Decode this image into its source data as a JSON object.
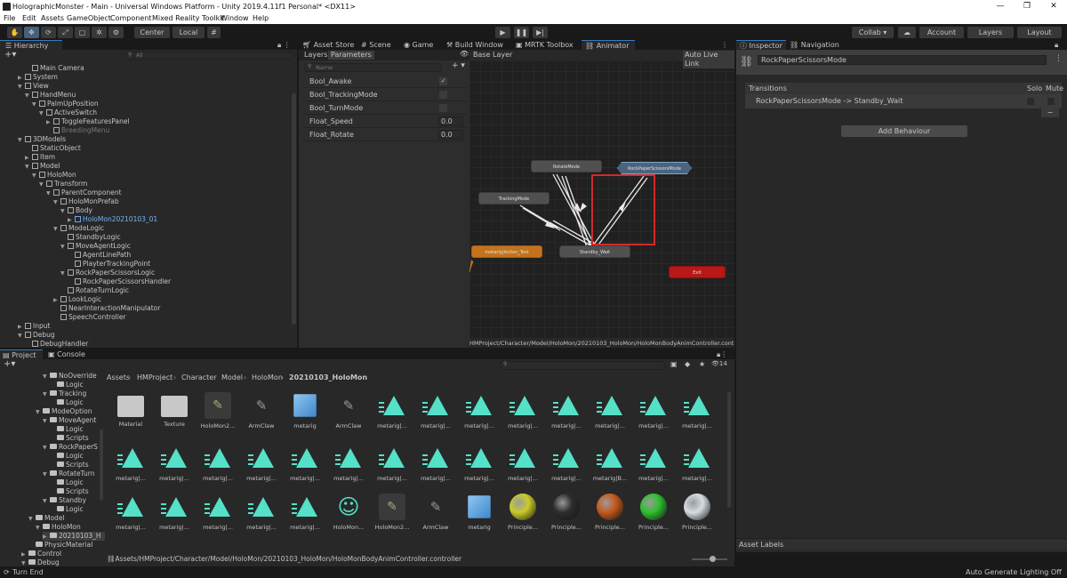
{
  "window": {
    "title": "HolographicMonster - Main - Universal Windows Platform - Unity 2019.4.11f1 Personal* <DX11>",
    "controls": [
      "—",
      "❐",
      "✕"
    ]
  },
  "menu": [
    "File",
    "Edit",
    "Assets",
    "GameObject",
    "Component",
    "Mixed Reality Toolkit",
    "Window",
    "Help"
  ],
  "toolbar": {
    "pivot_label": "Center",
    "space_label": "Local",
    "collab_label": "Collab ▾",
    "account_label": "Account",
    "layers_label": "Layers",
    "layout_label": "Layout"
  },
  "hierarchy": {
    "tab_label": "Hierarchy",
    "search_placeholder": "All",
    "rows": [
      {
        "label": "Main Camera",
        "depth": 3,
        "arrow": "",
        "icon": "cube"
      },
      {
        "label": "System",
        "depth": 2,
        "arrow": "▶",
        "icon": "cube"
      },
      {
        "label": "View",
        "depth": 2,
        "arrow": "▼",
        "icon": "cube"
      },
      {
        "label": "HandMenu",
        "depth": 3,
        "arrow": "▼",
        "icon": "cube"
      },
      {
        "label": "PalmUpPosition",
        "depth": 4,
        "arrow": "▼",
        "icon": "cube"
      },
      {
        "label": "ActiveSwitch",
        "depth": 5,
        "arrow": "▼",
        "icon": "cube"
      },
      {
        "label": "ToggleFeaturesPanel",
        "depth": 6,
        "arrow": "▶",
        "icon": "cube"
      },
      {
        "label": "BreedingMenu",
        "depth": 6,
        "arrow": "",
        "icon": "cube",
        "dim": true
      },
      {
        "label": "3DModels",
        "depth": 2,
        "arrow": "▼",
        "icon": "cube"
      },
      {
        "label": "StaticObject",
        "depth": 3,
        "arrow": "",
        "icon": "cube"
      },
      {
        "label": "Item",
        "depth": 3,
        "arrow": "▶",
        "icon": "cube"
      },
      {
        "label": "Model",
        "depth": 3,
        "arrow": "▼",
        "icon": "cube"
      },
      {
        "label": "HoloMon",
        "depth": 4,
        "arrow": "▼",
        "icon": "cube"
      },
      {
        "label": "Transform",
        "depth": 5,
        "arrow": "▼",
        "icon": "cube"
      },
      {
        "label": "ParentComponent",
        "depth": 6,
        "arrow": "▼",
        "icon": "cube"
      },
      {
        "label": "HoloMonPrefab",
        "depth": 7,
        "arrow": "▼",
        "icon": "cube"
      },
      {
        "label": "Body",
        "depth": 8,
        "arrow": "▼",
        "icon": "cube"
      },
      {
        "label": "HoloMon20210103_01",
        "depth": 9,
        "arrow": "▶",
        "icon": "blue"
      },
      {
        "label": "ModeLogic",
        "depth": 7,
        "arrow": "▼",
        "icon": "cube"
      },
      {
        "label": "StandbyLogic",
        "depth": 8,
        "arrow": "",
        "icon": "cube"
      },
      {
        "label": "MoveAgentLogic",
        "depth": 8,
        "arrow": "▼",
        "icon": "cube"
      },
      {
        "label": "AgentLinePath",
        "depth": 9,
        "arrow": "",
        "icon": "cube"
      },
      {
        "label": "PlayterTrackingPoint",
        "depth": 9,
        "arrow": "",
        "icon": "cube"
      },
      {
        "label": "RockPaperScissorsLogic",
        "depth": 8,
        "arrow": "▼",
        "icon": "cube"
      },
      {
        "label": "RockPaperScissorsHandler",
        "depth": 9,
        "arrow": "",
        "icon": "cube"
      },
      {
        "label": "RotateTurnLogic",
        "depth": 8,
        "arrow": "",
        "icon": "cube"
      },
      {
        "label": "LookLogic",
        "depth": 7,
        "arrow": "▶",
        "icon": "cube"
      },
      {
        "label": "NearInteractionManipulator",
        "depth": 7,
        "arrow": "",
        "icon": "cube"
      },
      {
        "label": "SpeechController",
        "depth": 7,
        "arrow": "",
        "icon": "cube"
      },
      {
        "label": "Input",
        "depth": 2,
        "arrow": "▶",
        "icon": "cube"
      },
      {
        "label": "Debug",
        "depth": 2,
        "arrow": "▼",
        "icon": "cube"
      },
      {
        "label": "DebugHandler",
        "depth": 3,
        "arrow": "",
        "icon": "cube"
      }
    ]
  },
  "center_tabs": [
    "Asset Store",
    "Scene",
    "Game",
    "Build Window",
    "MRTK Toolbox",
    "Animator"
  ],
  "animator": {
    "layers_tab": "Layers",
    "parameters_tab": "Parameters",
    "search_placeholder": "Name",
    "add_button": "+ ▾",
    "layer_name": "Base Layer",
    "auto_live_link": "Auto Live Link",
    "parameters": [
      {
        "name": "Bool_Awake",
        "type": "bool",
        "value": "✓"
      },
      {
        "name": "Bool_TrackingMode",
        "type": "bool",
        "value": ""
      },
      {
        "name": "Bool_TurnMode",
        "type": "bool",
        "value": ""
      },
      {
        "name": "Float_Speed",
        "type": "float",
        "value": "0.0"
      },
      {
        "name": "Float_Rotate",
        "type": "float",
        "value": "0.0"
      }
    ],
    "states": {
      "rotate": "RotateMode",
      "rps": "RockPaperScissorsMode",
      "tracking": "TrackingMode",
      "standby": "Standby_Wait",
      "action": "metarig|Action_Test",
      "exit": "Exit"
    },
    "path": "HMProject/Character/Model/HoloMon/20210103_HoloMon/HoloMonBodyAnimController.controller"
  },
  "inspector": {
    "tab_label": "Inspector",
    "nav_label": "Navigation",
    "object_name": "RockPaperScissorsMode",
    "transitions_header": "Transitions",
    "solo_label": "Solo",
    "mute_label": "Mute",
    "transition_item": "RockPaperScissorsMode -> Standby_Wait",
    "minus_label": "−",
    "add_behaviour": "Add Behaviour",
    "asset_labels": "Asset Labels"
  },
  "project": {
    "tab_label": "Project",
    "console_label": "Console",
    "hidden_count": "14",
    "breadcrumb": [
      "Assets",
      "HMProject",
      "Character",
      "Model",
      "HoloMon",
      "20210103_HoloMon"
    ],
    "tree": [
      {
        "label": "NoOverride",
        "depth": 1,
        "arrow": "▼"
      },
      {
        "label": "Logic",
        "depth": 2,
        "arrow": ""
      },
      {
        "label": "Tracking",
        "depth": 1,
        "arrow": "▼"
      },
      {
        "label": "Logic",
        "depth": 2,
        "arrow": ""
      },
      {
        "label": "ModeOption",
        "depth": 0,
        "arrow": "▼"
      },
      {
        "label": "MoveAgent",
        "depth": 1,
        "arrow": "▼"
      },
      {
        "label": "Logic",
        "depth": 2,
        "arrow": ""
      },
      {
        "label": "Scripts",
        "depth": 2,
        "arrow": ""
      },
      {
        "label": "RockPaperS",
        "depth": 1,
        "arrow": "▼"
      },
      {
        "label": "Logic",
        "depth": 2,
        "arrow": ""
      },
      {
        "label": "Scripts",
        "depth": 2,
        "arrow": ""
      },
      {
        "label": "RotateTurn",
        "depth": 1,
        "arrow": "▼"
      },
      {
        "label": "Logic",
        "depth": 2,
        "arrow": ""
      },
      {
        "label": "Scripts",
        "depth": 2,
        "arrow": ""
      },
      {
        "label": "Standby",
        "depth": 1,
        "arrow": "▼"
      },
      {
        "label": "Logic",
        "depth": 2,
        "arrow": ""
      },
      {
        "label": "Model",
        "depth": -1,
        "arrow": "▼"
      },
      {
        "label": "HoloMon",
        "depth": 0,
        "arrow": "▼"
      },
      {
        "label": "20210103_H",
        "depth": 1,
        "arrow": "▶",
        "selected": true
      },
      {
        "label": "PhysicMaterial",
        "depth": -1,
        "arrow": ""
      },
      {
        "label": "Control",
        "depth": -2,
        "arrow": "▶"
      },
      {
        "label": "Debug",
        "depth": -2,
        "arrow": "▼"
      }
    ],
    "row1": [
      {
        "label": "Material",
        "kind": "folder"
      },
      {
        "label": "Texture",
        "kind": "folder"
      },
      {
        "label": "HoloMon2...",
        "kind": "fbx"
      },
      {
        "label": "ArmClaw",
        "kind": "mesh"
      },
      {
        "label": "metarig",
        "kind": "box"
      },
      {
        "label": "ArmClaw",
        "kind": "mesh2"
      },
      {
        "label": "metarig|...",
        "kind": "anim"
      },
      {
        "label": "metarig|...",
        "kind": "anim"
      },
      {
        "label": "metarig|...",
        "kind": "anim"
      },
      {
        "label": "metarig|...",
        "kind": "anim"
      },
      {
        "label": "metarig|...",
        "kind": "anim"
      },
      {
        "label": "metarig|...",
        "kind": "anim"
      },
      {
        "label": "metarig|...",
        "kind": "anim"
      },
      {
        "label": "metarig|...",
        "kind": "anim"
      }
    ],
    "row2": [
      {
        "label": "metarig|...",
        "kind": "anim"
      },
      {
        "label": "metarig|...",
        "kind": "anim"
      },
      {
        "label": "metarig|...",
        "kind": "anim"
      },
      {
        "label": "metarig|...",
        "kind": "anim"
      },
      {
        "label": "metarig|...",
        "kind": "anim"
      },
      {
        "label": "metarig|...",
        "kind": "anim"
      },
      {
        "label": "metarig|...",
        "kind": "anim"
      },
      {
        "label": "metarig|...",
        "kind": "anim"
      },
      {
        "label": "metarig|...",
        "kind": "anim"
      },
      {
        "label": "metarig|...",
        "kind": "anim"
      },
      {
        "label": "metarig|...",
        "kind": "anim"
      },
      {
        "label": "metarig|B...",
        "kind": "anim"
      },
      {
        "label": "metarig|...",
        "kind": "anim"
      },
      {
        "label": "metarig|...",
        "kind": "anim"
      }
    ],
    "row3": [
      {
        "label": "metarig|...",
        "kind": "anim"
      },
      {
        "label": "metarig|...",
        "kind": "anim"
      },
      {
        "label": "metarig|...",
        "kind": "anim"
      },
      {
        "label": "metarig|...",
        "kind": "anim"
      },
      {
        "label": "metarig|...",
        "kind": "anim"
      },
      {
        "label": "HoloMon...",
        "kind": "avatar"
      },
      {
        "label": "HoloMon2...",
        "kind": "fbx"
      },
      {
        "label": "ArmClaw",
        "kind": "mesh"
      },
      {
        "label": "metarig",
        "kind": "box"
      },
      {
        "label": "Principle...",
        "kind": "ball",
        "color": "#c9cc2a"
      },
      {
        "label": "Principle...",
        "kind": "ball",
        "color": "#2d2d2d"
      },
      {
        "label": "Principle...",
        "kind": "ball",
        "color": "#c45a1c"
      },
      {
        "label": "Principle...",
        "kind": "ball",
        "color": "#2fc02f"
      },
      {
        "label": "Principle...",
        "kind": "ball",
        "color": "#d7dde4"
      }
    ],
    "bottom_path": "Assets/HMProject/Character/Model/HoloMon/20210103_HoloMon/HoloMonBodyAnimController.controller"
  },
  "statusbar": {
    "left": "Turn End",
    "right": "Auto Generate Lighting Off"
  },
  "colors": {
    "highlight_box": "#d42a2a",
    "anim_icon": "#55e0c8",
    "orange_state": "#c4731c",
    "exit_state": "#b81818",
    "selected_state": "#4a6480"
  }
}
